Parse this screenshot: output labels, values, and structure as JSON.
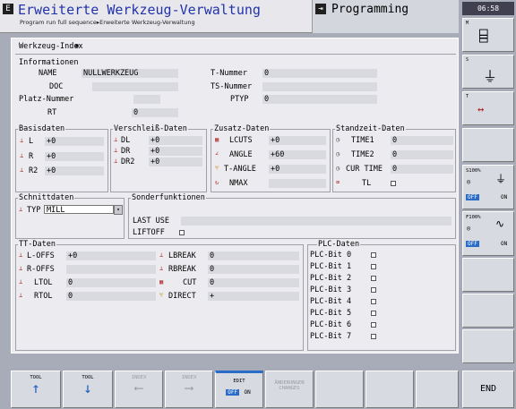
{
  "header": {
    "mode_icon": "E",
    "title": "Erweiterte Werkzeug-Verwaltung",
    "breadcrumb": "Program run full sequence▸Erweiterte Werkzeug-Verwaltung",
    "program_label": "Programming"
  },
  "clock": "06:58",
  "tool_index": {
    "label": "Werkzeug-Index"
  },
  "info": {
    "title": "Informationen",
    "name_label": "NAME",
    "name_value": "NULLWERKZEUG",
    "tnum_label": "T-Nummer",
    "tnum_value": "0",
    "doc_label": "DOC",
    "doc_value": "",
    "tsnum_label": "TS-Nummer",
    "tsnum_value": "",
    "platz_label": "Platz-Nummer",
    "platz_value": "",
    "ptyp_label": "PTYP",
    "ptyp_value": "0",
    "rt_label": "RT",
    "rt_value": "0"
  },
  "basis": {
    "title": "Basisdaten",
    "rows": [
      {
        "l": "L",
        "v": "+0"
      },
      {
        "l": "R",
        "v": "+0"
      },
      {
        "l": "R2",
        "v": "+0"
      }
    ]
  },
  "wear": {
    "title": "Verschleiß-Daten",
    "rows": [
      {
        "l": "DL",
        "v": "+0"
      },
      {
        "l": "DR",
        "v": "+0"
      },
      {
        "l": "DR2",
        "v": "+0"
      }
    ]
  },
  "extra": {
    "title": "Zusatz-Daten",
    "rows": [
      {
        "l": "LCUTS",
        "v": "+0"
      },
      {
        "l": "ANGLE",
        "v": "+60"
      },
      {
        "l": "T-ANGLE",
        "v": "+0"
      },
      {
        "l": "NMAX",
        "v": ""
      }
    ]
  },
  "life": {
    "title": "Standzeit-Daten",
    "rows": [
      {
        "l": "TIME1",
        "v": "0"
      },
      {
        "l": "TIME2",
        "v": "0"
      },
      {
        "l": "CUR TIME",
        "v": "0"
      },
      {
        "l": "TL",
        "v": ""
      }
    ]
  },
  "cut": {
    "title": "Schnittdaten",
    "typ_label": "TYP",
    "typ_value": "MILL"
  },
  "special": {
    "title": "Sonderfunktionen",
    "last_use_label": "LAST USE",
    "last_use_value": "",
    "liftoff_label": "LIFTOFF"
  },
  "tt": {
    "title": "TT-Daten",
    "left": [
      {
        "l": "L-OFFS",
        "v": "+0"
      },
      {
        "l": "R-OFFS",
        "v": ""
      },
      {
        "l": "LTOL",
        "v": "0"
      },
      {
        "l": "RTOL",
        "v": "0"
      }
    ],
    "right": [
      {
        "l": "LBREAK",
        "v": "0"
      },
      {
        "l": "RBREAK",
        "v": "0"
      },
      {
        "l": "CUT",
        "v": "0"
      },
      {
        "l": "DIRECT",
        "v": "+"
      }
    ]
  },
  "plc": {
    "title": "PLC-Daten",
    "bits": [
      "PLC-Bit 0",
      "PLC-Bit 1",
      "PLC-Bit 2",
      "PLC-Bit 3",
      "PLC-Bit 4",
      "PLC-Bit 5",
      "PLC-Bit 6",
      "PLC-Bit 7"
    ]
  },
  "side": {
    "s1": "M",
    "s2": "S",
    "s3": "T",
    "feed1": "S100%",
    "feed2": "F100%",
    "off": "OFF",
    "on": "ON"
  },
  "bottom": {
    "tool_up": "TOOL",
    "tool_down": "TOOL",
    "index_prev": "INDEX",
    "index_next": "INDEX",
    "edit": "EDIT",
    "off": "OFF",
    "on": "ON",
    "reset": "ÄNDERUNGEN",
    "changes": "CHANGES",
    "end": "END"
  }
}
